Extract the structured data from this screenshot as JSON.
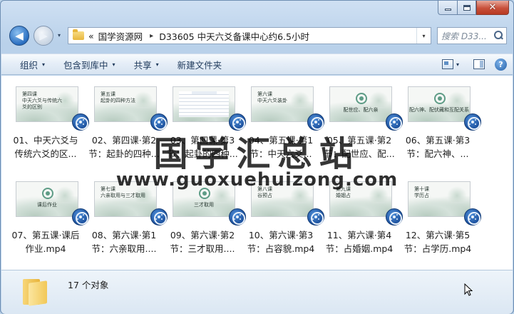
{
  "window": {
    "caption_buttons": [
      "minimize",
      "maximize",
      "close"
    ],
    "close_glyph": "✕"
  },
  "address": {
    "recent_arrow": "▾",
    "overflow": "«",
    "crumbs": [
      "国学资源网",
      "D33605 中天六爻备课中心约6.5小时"
    ],
    "separator": "▸",
    "dropdown": "▾",
    "refresh_glyph": "↻"
  },
  "search": {
    "placeholder": "搜索 D33..."
  },
  "toolbar": {
    "organize": "组织",
    "include_library": "包含到库中",
    "share": "共享",
    "new_folder": "新建文件夹",
    "arrow": "▾",
    "help": "?"
  },
  "files": [
    {
      "label": "01、中天六爻与\n传统六爻的区...",
      "thumb": "title",
      "thumb_text": "第四课\n中天六爻与传统六\n爻的区别"
    },
    {
      "label": "02、第四课·第2\n节：起卦的四种...",
      "thumb": "title",
      "thumb_text": "第五课\n起卦的四种方法"
    },
    {
      "label": "03、第四课·第3\n节：起卦的四种...",
      "thumb": "doc",
      "thumb_text": ""
    },
    {
      "label": "04、第五课·第1\n节：中天六爻...",
      "thumb": "title",
      "thumb_text": "第六课\n中天六爻装卦"
    },
    {
      "label": "05、第五课·第2\n节：配世应、配...",
      "thumb": "logo",
      "thumb_text": "配世应、配六亲"
    },
    {
      "label": "06、第五课·第3\n节：配六神、...",
      "thumb": "logo",
      "thumb_text": "配六神、配伏藏和互配关系"
    },
    {
      "label": "07、第五课·课后\n作业.mp4",
      "thumb": "logo",
      "thumb_text": "课后作业"
    },
    {
      "label": "08、第六课·第1\n节：六亲取用....",
      "thumb": "title",
      "thumb_text": "第七课\n六亲取用与三才取用"
    },
    {
      "label": "09、第六课·第2\n节：三才取用....",
      "thumb": "logo",
      "thumb_text": "三才取用"
    },
    {
      "label": "10、第六课·第3\n节：占容貌.mp4",
      "thumb": "title",
      "thumb_text": "第八课\n谷预占"
    },
    {
      "label": "11、第六课·第4\n节：占婚姻.mp4",
      "thumb": "title",
      "thumb_text": "第九课\n婚姻占"
    },
    {
      "label": "12、第六课·第5\n节：占学历.mp4",
      "thumb": "title",
      "thumb_text": "第十课\n学历占"
    }
  ],
  "details": {
    "count": "17 个对象"
  },
  "watermark": {
    "cn": "国学汇总站",
    "url": "www.guoxuehuizong.com"
  },
  "colors": {
    "accent": "#2a6ec0",
    "close": "#c8503b",
    "folder": "#f2c858"
  }
}
